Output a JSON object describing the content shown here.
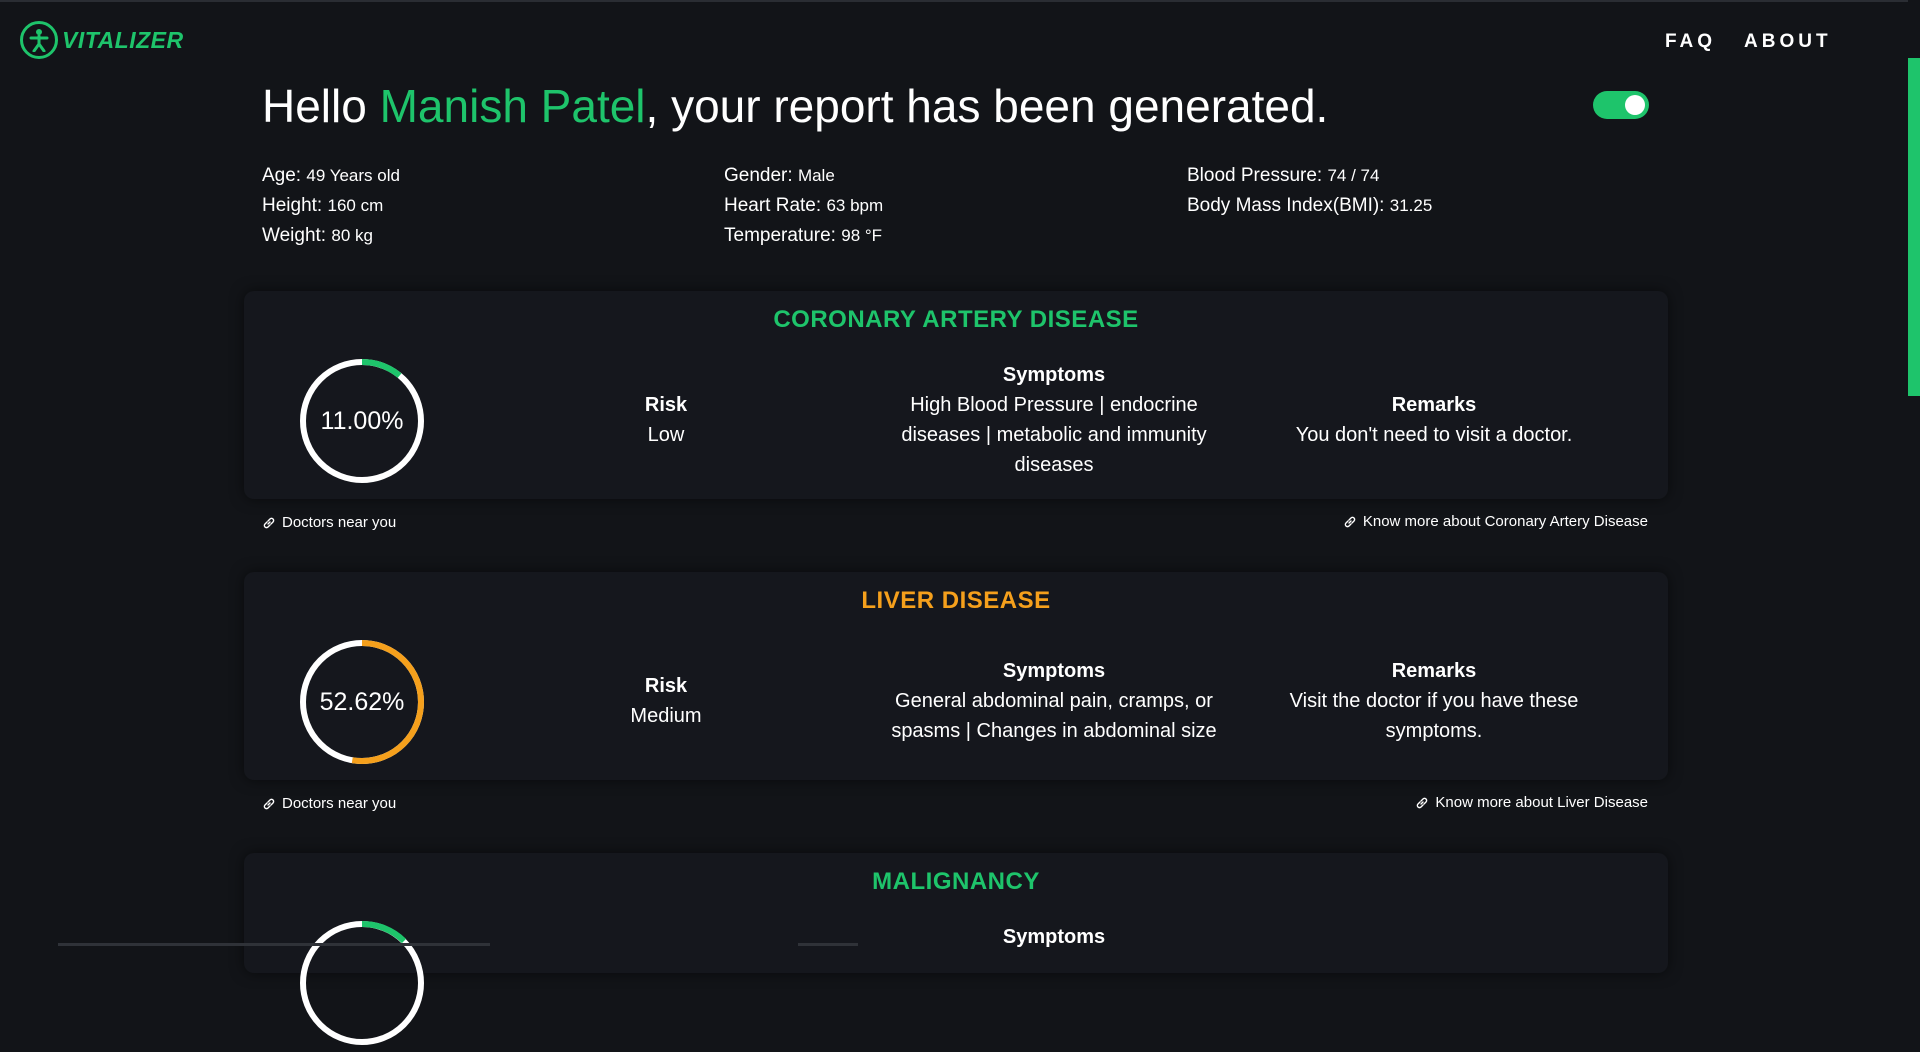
{
  "brand": {
    "name": "VITALIZER"
  },
  "nav": {
    "faq": "FAQ",
    "about": "ABOUT"
  },
  "greeting": {
    "prefix": "Hello ",
    "name": "Manish Patel",
    "suffix": ", your report has been generated."
  },
  "toggle": {
    "state": "on"
  },
  "patient": {
    "age_label": "Age: ",
    "age_value": "49 Years old",
    "height_label": "Height: ",
    "height_value": "160 cm",
    "weight_label": "Weight: ",
    "weight_value": "80 kg",
    "gender_label": "Gender: ",
    "gender_value": "Male",
    "heart_rate_label": "Heart Rate: ",
    "heart_rate_value": "63 bpm",
    "temperature_label": "Temperature: ",
    "temperature_value": "98 °F",
    "bp_label": "Blood Pressure: ",
    "bp_value": "74 / 74",
    "bmi_label": "Body Mass Index(BMI): ",
    "bmi_value": "31.25"
  },
  "cards": [
    {
      "title": "CORONARY ARTERY DISEASE",
      "color": "#1ec46b",
      "percent_text": "11.00%",
      "percent_value": 11.0,
      "risk_label": "Risk",
      "risk_value": "Low",
      "symptoms_label": "Symptoms",
      "symptoms_value": "High Blood Pressure | endocrine diseases | metabolic and immunity diseases",
      "remarks_label": "Remarks",
      "remarks_value": "You don't need to visit a doctor.",
      "doctors_link": "Doctors near you",
      "know_more_link": "Know more about Coronary Artery Disease"
    },
    {
      "title": "LIVER DISEASE",
      "color": "#f5a01c",
      "percent_text": "52.62%",
      "percent_value": 52.62,
      "risk_label": "Risk",
      "risk_value": "Medium",
      "symptoms_label": "Symptoms",
      "symptoms_value": "General abdominal pain, cramps, or spasms | Changes in abdominal size",
      "remarks_label": "Remarks",
      "remarks_value": "Visit the doctor if you have these symptoms.",
      "doctors_link": "Doctors near you",
      "know_more_link": "Know more about Liver Disease"
    },
    {
      "title": "MALIGNANCY",
      "color": "#1ec46b",
      "symptoms_label": "Symptoms"
    }
  ]
}
